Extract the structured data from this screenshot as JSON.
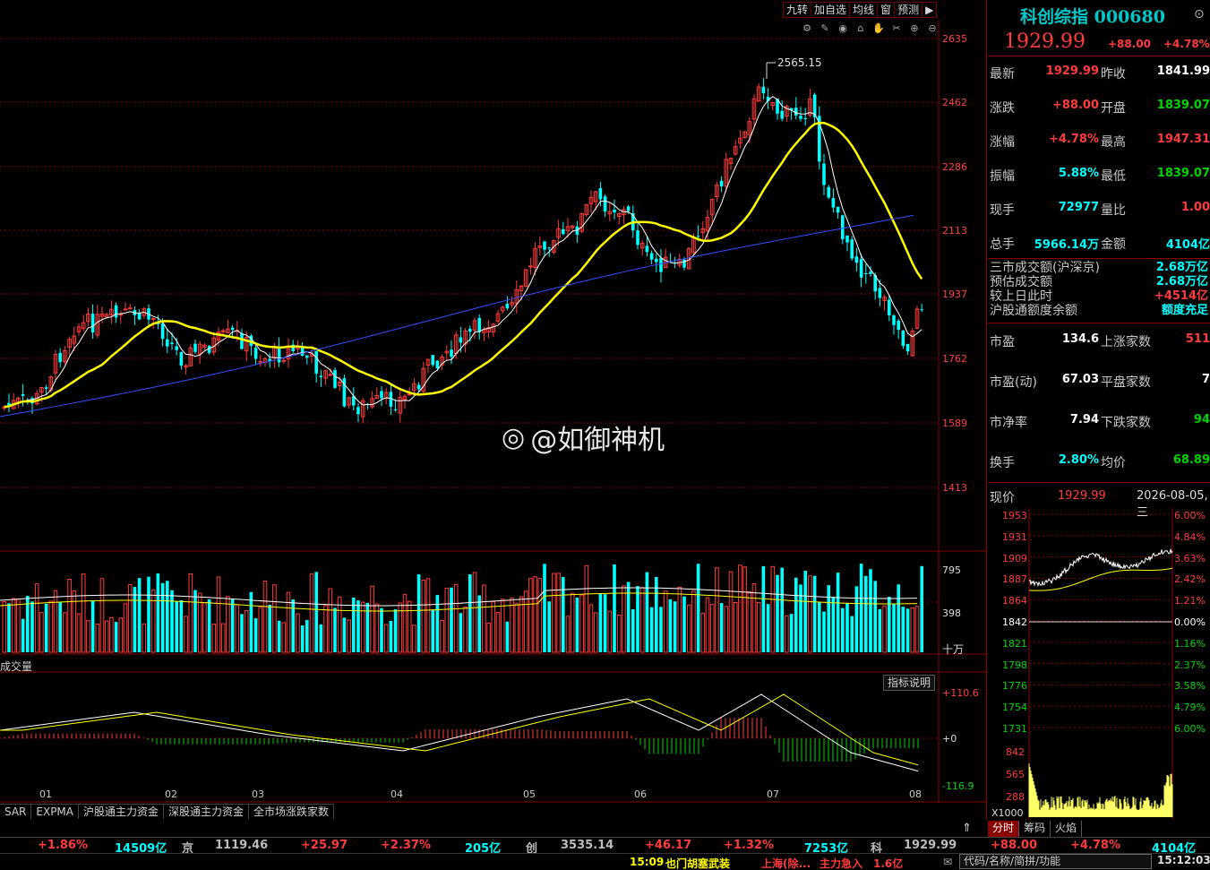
{
  "toolbar": {
    "items": [
      "九转",
      "加自选",
      "均线",
      "窗",
      "预测"
    ],
    "play_icon": "▶"
  },
  "icons": [
    "settings-icon",
    "pen-icon",
    "eye-icon",
    "lock-icon",
    "hand-icon",
    "scissors-icon",
    "zoom-in-icon",
    "zoom-out-icon"
  ],
  "main_chart": {
    "y_ticks": [
      "2635",
      "2462",
      "2286",
      "2113",
      "1937",
      "1762",
      "1589",
      "1413"
    ],
    "peak_label": "2565.15"
  },
  "volume": {
    "y_ticks": [
      "795",
      "398"
    ],
    "unit": "十万",
    "label": "成交量"
  },
  "macd": {
    "y_ticks": [
      "+110.6",
      "+0",
      "-116.9"
    ],
    "indicator_button": "指标说明"
  },
  "months": [
    "01",
    "02",
    "03",
    "04",
    "05",
    "06",
    "07",
    "08"
  ],
  "bottom_tabs": [
    "SAR",
    "EXPMA",
    "沪股通主力资金",
    "深股通主力资金",
    "全市场涨跌家数"
  ],
  "watermark": "@如御神机",
  "quote": {
    "name": "科创综指",
    "code": "000680",
    "price": "1929.99",
    "change": "+88.00",
    "change_pct": "+4.78%",
    "rows": [
      {
        "l1": "最新",
        "v1": "1929.99",
        "c1": "red",
        "l2": "昨收",
        "v2": "1841.99",
        "c2": "white"
      },
      {
        "l1": "涨跌",
        "v1": "+88.00",
        "c1": "red",
        "l2": "开盘",
        "v2": "1839.07",
        "c2": "green"
      },
      {
        "l1": "涨幅",
        "v1": "+4.78%",
        "c1": "red",
        "l2": "最高",
        "v2": "1947.31",
        "c2": "red"
      },
      {
        "l1": "振幅",
        "v1": "5.88%",
        "c1": "cyan",
        "l2": "最低",
        "v2": "1839.07",
        "c2": "green"
      },
      {
        "l1": "现手",
        "v1": "72977",
        "c1": "cyan",
        "l2": "量比",
        "v2": "1.00",
        "c2": "red"
      },
      {
        "l1": "总手",
        "v1": "5966.14万",
        "c1": "cyan",
        "l2": "金额",
        "v2": "4104亿",
        "c2": "cyan"
      }
    ],
    "market_rows": [
      {
        "l": "三市成交额(沪深京)",
        "v": "2.68万亿",
        "c": "cyan"
      },
      {
        "l": "预估成交额",
        "v": "2.68万亿",
        "c": "cyan"
      },
      {
        "l": "较上日此时",
        "v": "+4514亿",
        "c": "red"
      },
      {
        "l": "沪股通额度余额",
        "v": "额度充足",
        "c": "cyan"
      }
    ],
    "ratio_rows": [
      {
        "l1": "市盈",
        "v1": "134.6",
        "c1": "white",
        "l2": "上涨家数",
        "v2": "511",
        "c2": "red"
      },
      {
        "l1": "市盈(动)",
        "v1": "67.03",
        "c1": "white",
        "l2": "平盘家数",
        "v2": "7",
        "c2": "white"
      },
      {
        "l1": "市净率",
        "v1": "7.94",
        "c1": "white",
        "l2": "下跌家数",
        "v2": "94",
        "c2": "green"
      },
      {
        "l1": "换手",
        "v1": "2.80%",
        "c1": "cyan",
        "l2": "均价",
        "v2": "68.89",
        "c2": "green"
      }
    ],
    "current_label": "现价",
    "current_value": "1929.99",
    "date": "2026-08-05,三"
  },
  "mini_chart": {
    "left_ticks": [
      "1953",
      "1931",
      "1909",
      "1887",
      "1864",
      "1842",
      "1821",
      "1798",
      "1776",
      "1754",
      "1731"
    ],
    "right_ticks": [
      "6.00%",
      "4.84%",
      "3.63%",
      "2.42%",
      "1.21%",
      "0.00%",
      "1.16%",
      "2.37%",
      "3.58%",
      "4.79%",
      "6.00%"
    ],
    "vol_ticks": [
      "842",
      "565",
      "288"
    ],
    "vol_unit": "X1000",
    "tabs": [
      "分时",
      "筹码",
      "火焰"
    ]
  },
  "index_bar": [
    {
      "t": "+1.86%",
      "c": "red",
      "x": 42
    },
    {
      "t": "14509亿",
      "c": "cyan",
      "x": 128
    },
    {
      "t": "京",
      "c": "gray",
      "x": 203
    },
    {
      "t": "1119.46",
      "c": "gray",
      "x": 240
    },
    {
      "t": "+25.97",
      "c": "red",
      "x": 336
    },
    {
      "t": "+2.37%",
      "c": "red",
      "x": 425
    },
    {
      "t": "205亿",
      "c": "cyan",
      "x": 519
    },
    {
      "t": "创",
      "c": "gray",
      "x": 587
    },
    {
      "t": "3535.14",
      "c": "gray",
      "x": 626
    },
    {
      "t": "+46.17",
      "c": "red",
      "x": 720
    },
    {
      "t": "+1.32%",
      "c": "red",
      "x": 808
    },
    {
      "t": "7253亿",
      "c": "cyan",
      "x": 898
    },
    {
      "t": "科",
      "c": "gray",
      "x": 972
    },
    {
      "t": "1929.99",
      "c": "gray",
      "x": 1009
    },
    {
      "t": "+88.00",
      "c": "red",
      "x": 1106
    },
    {
      "t": "+4.78%",
      "c": "red",
      "x": 1195
    },
    {
      "t": "4104亿",
      "c": "cyan",
      "x": 1286
    }
  ],
  "ticker": {
    "time": "15:09",
    "news": "也门胡塞武装",
    "market": "上海(除...",
    "flow": "主力急入",
    "flow_value": "1.6亿",
    "search_placeholder": "代码/名称/简拼/功能",
    "clock": "15:12:03"
  },
  "colors": {
    "up": "#ff3b3b",
    "down": "#00ffff",
    "ma_yellow": "#ffff00",
    "ma_blue": "#3050ff",
    "grid": "#8b0000"
  }
}
